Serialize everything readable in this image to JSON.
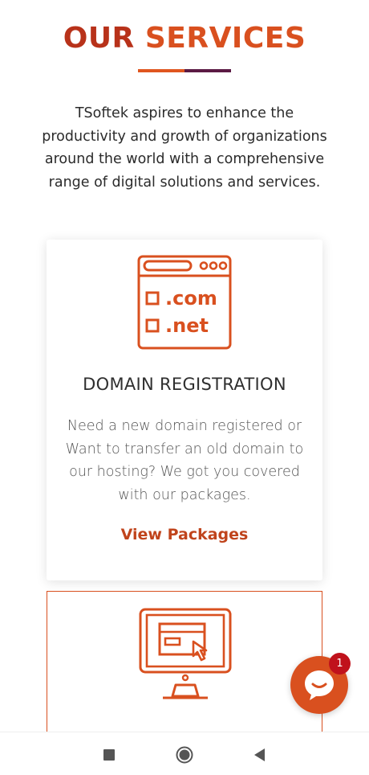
{
  "section": {
    "title_part1": "OUR",
    "title_part2": "SERVICES",
    "intro": "TSoftek aspires to enhance the productivity and growth of organizations around the world with a comprehensive range of digital solutions and services."
  },
  "cards": [
    {
      "icon": "domain-browser-icon",
      "icon_text_1": ".com",
      "icon_text_2": ".net",
      "title": "DOMAIN REGISTRATION",
      "description": "Need a new domain registered or Want to transfer an old domain to our hosting? We got you covered with our packages.",
      "link_label": "View Packages"
    },
    {
      "icon": "monitor-click-icon"
    }
  ],
  "chat_widget": {
    "icon": "chat-bubble-icon",
    "badge_count": "1"
  },
  "system_nav": {
    "recents_icon": "square-icon",
    "home_icon": "circle-icon",
    "back_icon": "triangle-back-icon"
  },
  "colors": {
    "accent_orange": "#d9501f",
    "accent_red": "#b8321a",
    "accent_purple": "#5b1a44",
    "badge_red": "#c0121c"
  }
}
